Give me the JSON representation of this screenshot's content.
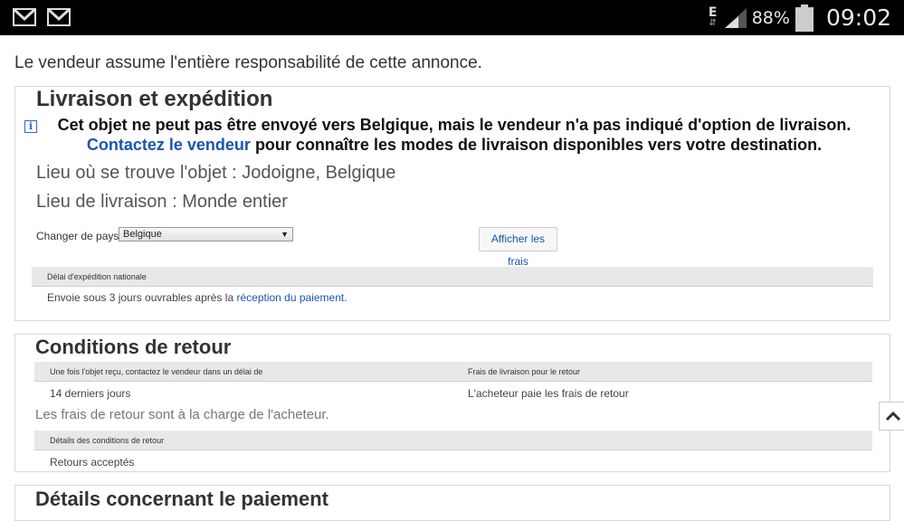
{
  "statusbar": {
    "network": "E",
    "battery": "88%",
    "time": "09:02"
  },
  "disclaimer": "Le vendeur assume l'entière responsabilité de cette annonce.",
  "shipping": {
    "title": "Livraison et expédition",
    "notice_main": "Cet objet ne peut pas être envoyé vers Belgique, mais le vendeur n'a pas indiqué d'option de livraison.",
    "notice_link": "Contactez le vendeur",
    "notice_end": "pour connaître les modes de livraison disponibles vers votre destination.",
    "item_location": "Lieu où se trouve l'objet : Jodoigne, Belgique",
    "ship_to": "Lieu de livraison : Monde entier",
    "country_label": "Changer de pays :",
    "country_value": "Belgique",
    "show_costs_button": "Afficher les frais",
    "handling_header": "Délai d'expédition nationale",
    "handling_text": "Envoie sous 3 jours ouvrables après la",
    "handling_link": "réception du paiement."
  },
  "returns": {
    "title": "Conditions de retour",
    "col1_header": "Une fois l'objet reçu, contactez le vendeur dans un délai de",
    "col2_header": "Frais de livraison pour le retour",
    "col1_value": "14 derniers jours",
    "col2_value": "L'acheteur paie les frais de retour",
    "note": "Les frais de retour sont à la charge de l'acheteur.",
    "details_header": "Détails des conditions de retour",
    "details_value": "Retours acceptés"
  },
  "payment": {
    "title": "Détails concernant le paiement"
  }
}
